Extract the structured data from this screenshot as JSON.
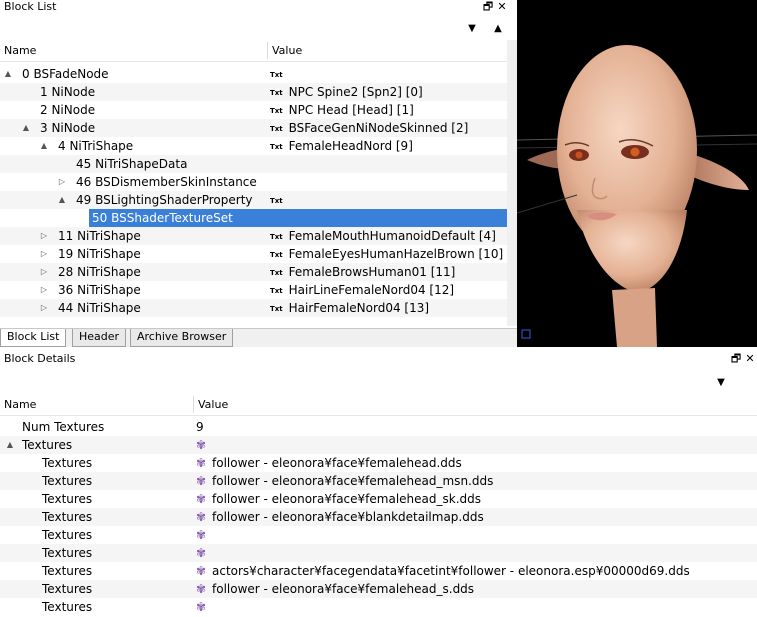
{
  "blocklist": {
    "title": "Block List",
    "col_name": "Name",
    "col_value": "Value",
    "rows": [
      {
        "name": "0 BSFadeNode",
        "value": "",
        "txt": true,
        "arrow": "▲",
        "indent": 0
      },
      {
        "name": "1 NiNode",
        "value": "NPC Spine2 [Spn2] [0]",
        "txt": true,
        "arrow": "",
        "indent": 1
      },
      {
        "name": "2 NiNode",
        "value": "NPC Head [Head] [1]",
        "txt": true,
        "arrow": "",
        "indent": 1
      },
      {
        "name": "3 NiNode",
        "value": "BSFaceGenNiNodeSkinned [2]",
        "txt": true,
        "arrow": "▲",
        "indent": 1
      },
      {
        "name": "4 NiTriShape",
        "value": "FemaleHeadNord [9]",
        "txt": true,
        "arrow": "▲",
        "indent": 2
      },
      {
        "name": "45 NiTriShapeData",
        "value": "",
        "txt": false,
        "arrow": "",
        "indent": 3
      },
      {
        "name": "46 BSDismemberSkinInstance",
        "value": "",
        "txt": false,
        "arrow": "▷",
        "indent": 3
      },
      {
        "name": "49 BSLightingShaderProperty",
        "value": "",
        "txt": true,
        "arrow": "▲",
        "indent": 3
      },
      {
        "name": "50 BSShaderTextureSet",
        "value": "",
        "txt": false,
        "arrow": "",
        "indent": 4,
        "selected": true
      },
      {
        "name": "11 NiTriShape",
        "value": "FemaleMouthHumanoidDefault [4]",
        "txt": true,
        "arrow": "▷",
        "indent": 2
      },
      {
        "name": "19 NiTriShape",
        "value": "FemaleEyesHumanHazelBrown [10]",
        "txt": true,
        "arrow": "▷",
        "indent": 2
      },
      {
        "name": "28 NiTriShape",
        "value": "FemaleBrowsHuman01 [11]",
        "txt": true,
        "arrow": "▷",
        "indent": 2
      },
      {
        "name": "36 NiTriShape",
        "value": "HairLineFemaleNord04 [12]",
        "txt": true,
        "arrow": "▷",
        "indent": 2
      },
      {
        "name": "44 NiTriShape",
        "value": "HairFemaleNord04 [13]",
        "txt": true,
        "arrow": "▷",
        "indent": 2
      }
    ],
    "txt_label": "Txt",
    "tabs": [
      "Block List",
      "Header",
      "Archive Browser"
    ]
  },
  "details": {
    "title": "Block Details",
    "col_name": "Name",
    "col_value": "Value",
    "rows": [
      {
        "name": "Num Textures",
        "value": "9",
        "icon": false,
        "arrow": "",
        "indent": 1
      },
      {
        "name": "Textures",
        "value": "",
        "icon": true,
        "arrow": "▲",
        "indent": 1
      },
      {
        "name": "Textures",
        "value": "follower - eleonora¥face¥femalehead.dds",
        "icon": true,
        "arrow": "",
        "indent": 2
      },
      {
        "name": "Textures",
        "value": "follower - eleonora¥face¥femalehead_msn.dds",
        "icon": true,
        "arrow": "",
        "indent": 2
      },
      {
        "name": "Textures",
        "value": "follower - eleonora¥face¥femalehead_sk.dds",
        "icon": true,
        "arrow": "",
        "indent": 2
      },
      {
        "name": "Textures",
        "value": "follower - eleonora¥face¥blankdetailmap.dds",
        "icon": true,
        "arrow": "",
        "indent": 2
      },
      {
        "name": "Textures",
        "value": "",
        "icon": true,
        "arrow": "",
        "indent": 2
      },
      {
        "name": "Textures",
        "value": "",
        "icon": true,
        "arrow": "",
        "indent": 2
      },
      {
        "name": "Textures",
        "value": "actors¥character¥facegendata¥facetint¥follower - eleonora.esp¥00000d69.dds",
        "icon": true,
        "arrow": "",
        "indent": 2
      },
      {
        "name": "Textures",
        "value": "follower - eleonora¥face¥femalehead_s.dds",
        "icon": true,
        "arrow": "",
        "indent": 2
      },
      {
        "name": "Textures",
        "value": "",
        "icon": true,
        "arrow": "",
        "indent": 2
      }
    ]
  },
  "buttons": {
    "float": "🗗",
    "close": "✕",
    "collapse_all": "⌄⌄",
    "expand_all": "⌃⌃"
  },
  "icons": {
    "texture": "flower-icon",
    "txt": "txt-icon"
  },
  "colors": {
    "selection": "#3a80d8",
    "viewport_bg": "#000000",
    "skin": "#e8b99a"
  }
}
